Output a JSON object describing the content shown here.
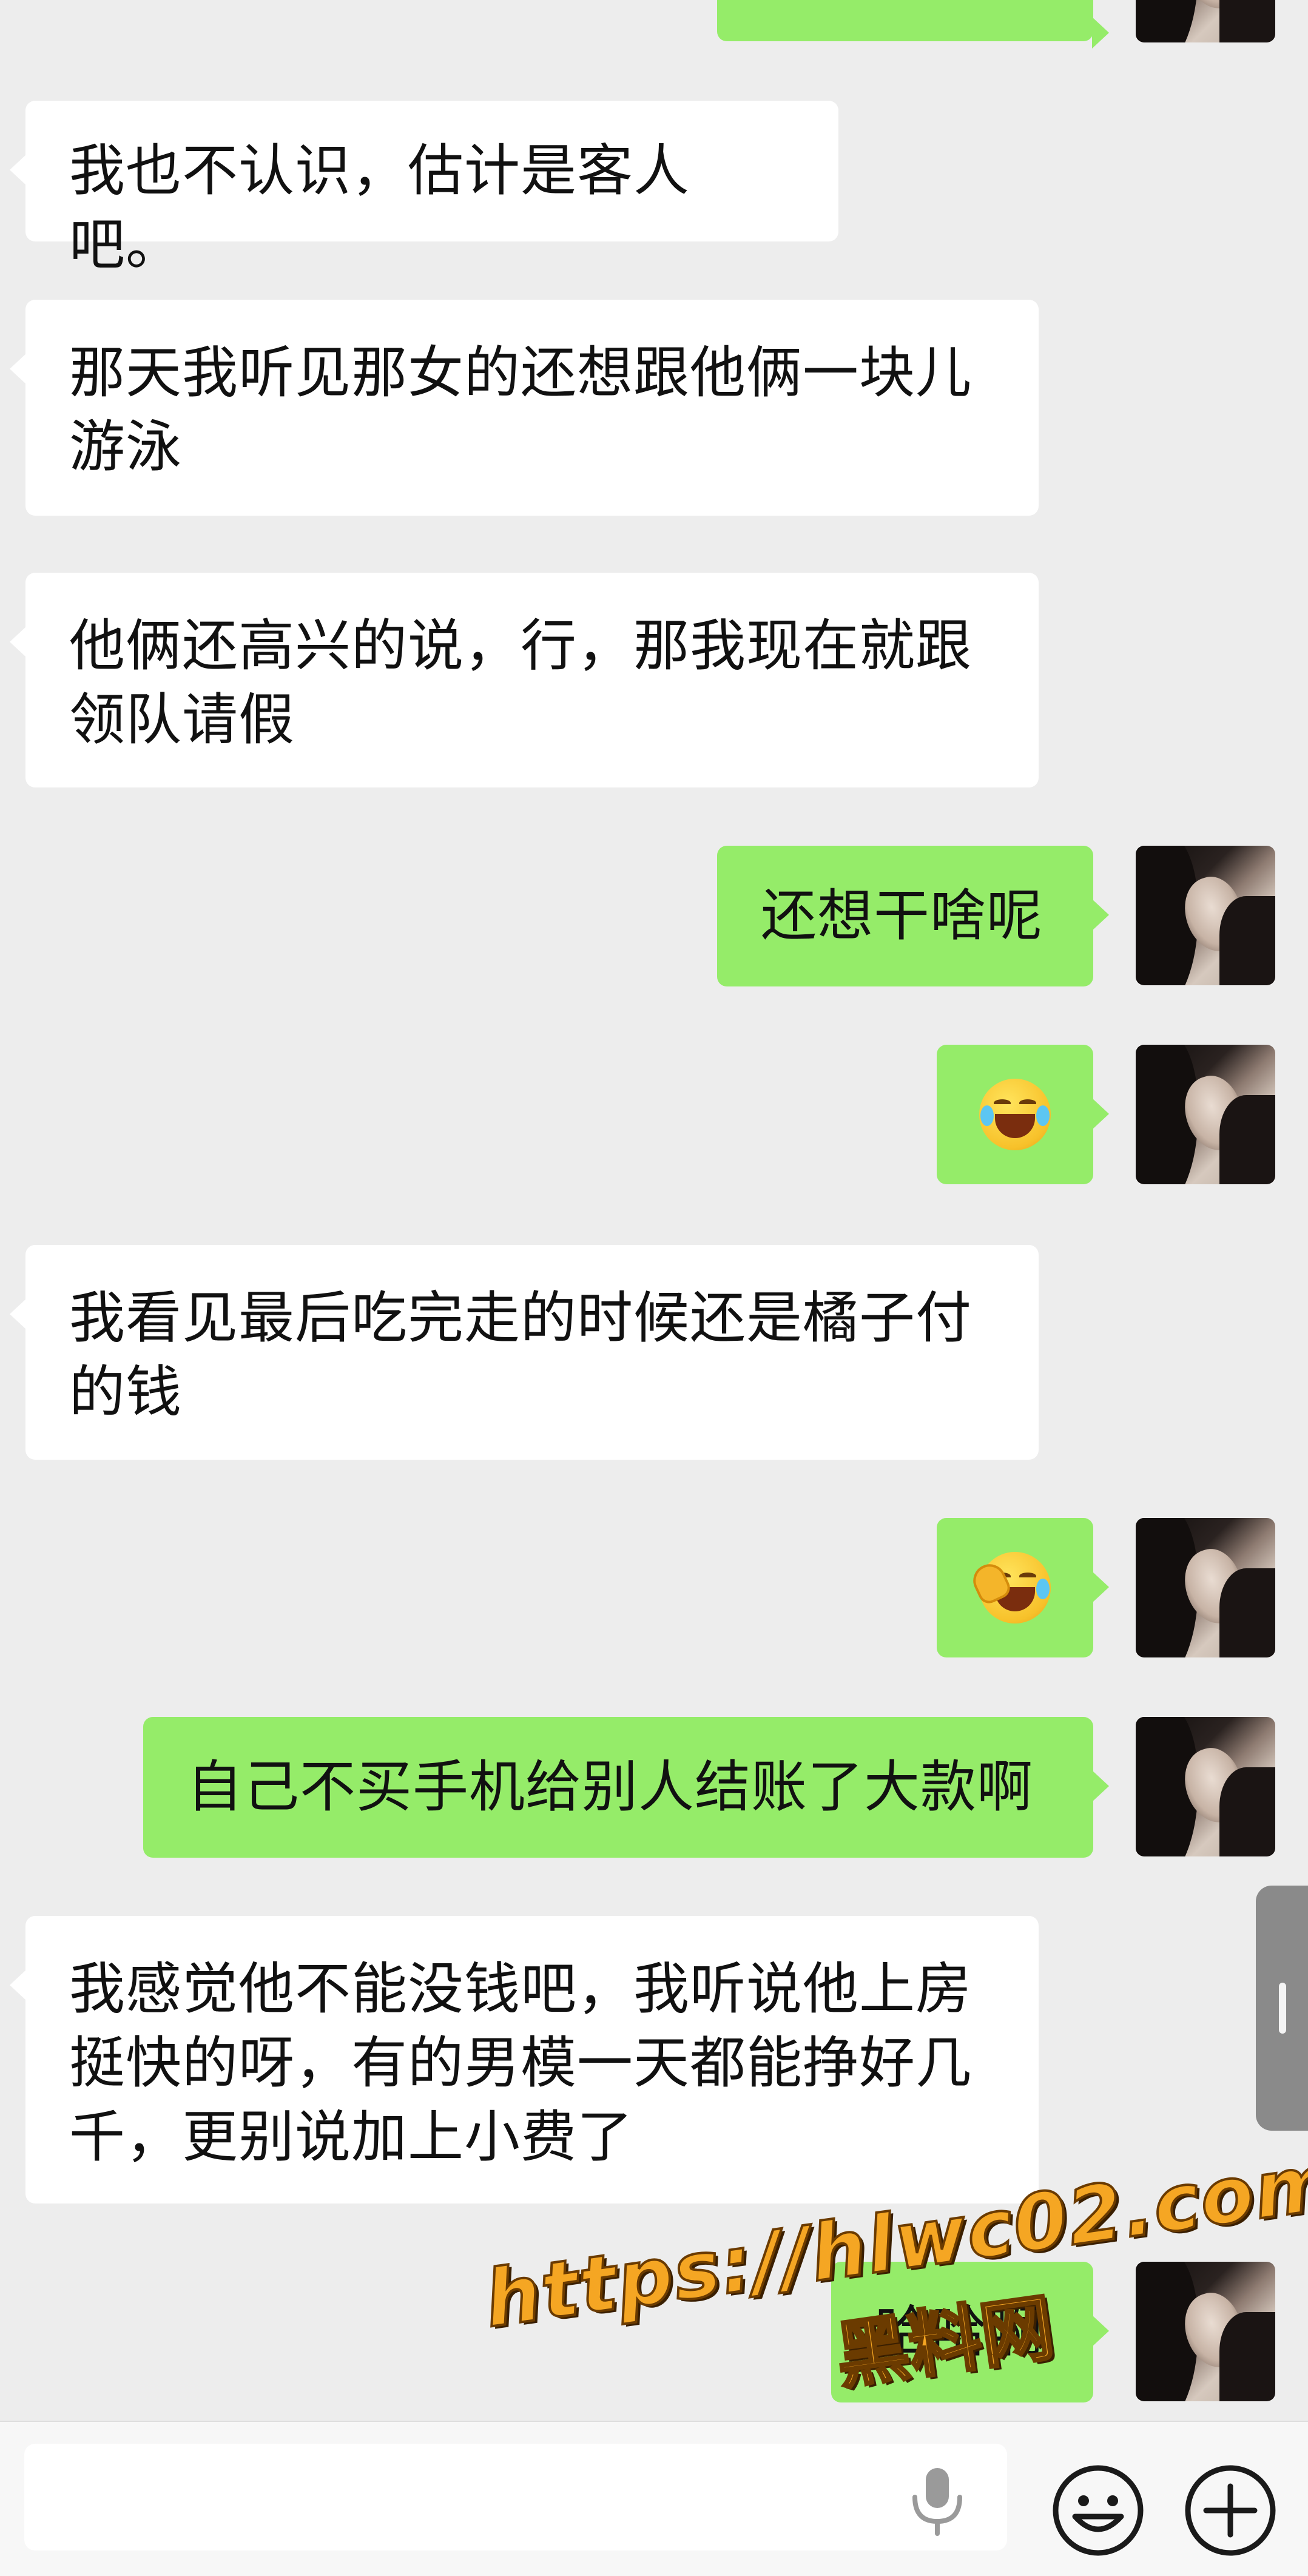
{
  "messages": [
    {
      "side": "in",
      "text": "我也不认识，估计是客人吧。"
    },
    {
      "side": "in",
      "text": "那天我听见那女的还想跟他俩一块儿游泳"
    },
    {
      "side": "in",
      "text": "他俩还高兴的说，行，那我现在就跟领队请假"
    },
    {
      "side": "out",
      "text": "还想干啥呢"
    },
    {
      "side": "out",
      "emoji": "laughing-crying-emoji"
    },
    {
      "side": "in",
      "text": "我看见最后吃完走的时候还是橘子付的钱"
    },
    {
      "side": "out",
      "emoji": "facepalm-crying-emoji"
    },
    {
      "side": "out",
      "text": "自己不买手机给别人结账了大款啊"
    },
    {
      "side": "in",
      "text": "我感觉他不能没钱吧，我听说他上房挺快的呀，有的男模一天都能挣好几千，更别说加上小费了"
    },
    {
      "side": "out",
      "text": "哈哈啊"
    }
  ],
  "watermark": {
    "url": "https://hlwc02.com",
    "label": "黑料网"
  },
  "input_bar": {
    "icons": [
      "microphone-icon",
      "emoji-icon",
      "plus-icon"
    ]
  },
  "colors": {
    "background": "#ededed",
    "incoming_bubble": "#ffffff",
    "outgoing_bubble": "#95ec69",
    "watermark": "#f5a623"
  }
}
